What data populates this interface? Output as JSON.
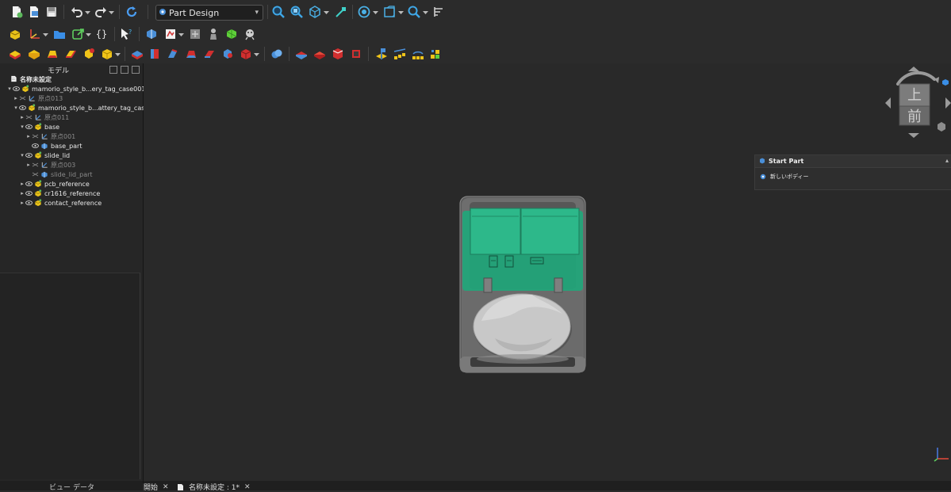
{
  "toolbar": {
    "workbench": "Part Design"
  },
  "panel": {
    "title": "モデル",
    "tabs": [
      "ビュー",
      "データ"
    ]
  },
  "tree": [
    {
      "label": "名称未設定",
      "depth": 0,
      "twisty": "",
      "eye": false,
      "icon": "document-icon",
      "dim": false,
      "bold": true
    },
    {
      "label": "mamorio_style_b...ery_tag_case001",
      "depth": 1,
      "twisty": "▾",
      "eye": true,
      "icon": "part-icon",
      "dim": false,
      "bold": false
    },
    {
      "label": "原点013",
      "depth": 2,
      "twisty": "▸",
      "eye": false,
      "icon": "origin-icon",
      "dim": true,
      "bold": false
    },
    {
      "label": "mamorio_style_b...attery_tag_case",
      "depth": 2,
      "twisty": "▾",
      "eye": true,
      "icon": "part-icon",
      "dim": false,
      "bold": false
    },
    {
      "label": "原点011",
      "depth": 3,
      "twisty": "▸",
      "eye": false,
      "icon": "origin-icon",
      "dim": true,
      "bold": false
    },
    {
      "label": "base",
      "depth": 3,
      "twisty": "▾",
      "eye": true,
      "icon": "part-icon",
      "dim": false,
      "bold": false
    },
    {
      "label": "原点001",
      "depth": 4,
      "twisty": "▸",
      "eye": false,
      "icon": "origin-icon",
      "dim": true,
      "bold": false
    },
    {
      "label": "base_part",
      "depth": 4,
      "twisty": "",
      "eye": true,
      "icon": "body-icon",
      "dim": false,
      "bold": false
    },
    {
      "label": "slide_lid",
      "depth": 3,
      "twisty": "▾",
      "eye": true,
      "icon": "part-icon",
      "dim": false,
      "bold": false
    },
    {
      "label": "原点003",
      "depth": 4,
      "twisty": "▸",
      "eye": false,
      "icon": "origin-icon",
      "dim": true,
      "bold": false
    },
    {
      "label": "slide_lid_part",
      "depth": 4,
      "twisty": "",
      "eye": false,
      "icon": "body-icon",
      "dim": true,
      "bold": false
    },
    {
      "label": "pcb_reference",
      "depth": 3,
      "twisty": "▸",
      "eye": true,
      "icon": "part-icon",
      "dim": false,
      "bold": false
    },
    {
      "label": "cr1616_reference",
      "depth": 3,
      "twisty": "▸",
      "eye": true,
      "icon": "part-icon",
      "dim": false,
      "bold": false
    },
    {
      "label": "contact_reference",
      "depth": 3,
      "twisty": "▸",
      "eye": true,
      "icon": "part-icon",
      "dim": false,
      "bold": false
    }
  ],
  "nav_cube": {
    "top_face": "上",
    "front_face": "前"
  },
  "task_panel": {
    "title": "Start Part",
    "action": "新しいボディー"
  },
  "doc_tabs": [
    {
      "label": "開始"
    },
    {
      "label": "名称未設定 : 1*"
    }
  ],
  "colors": {
    "lid_green": "#1fa67a",
    "case_gray": "#6e6e6e",
    "coin_cell": "#c8c8c8",
    "background": "#292929"
  }
}
